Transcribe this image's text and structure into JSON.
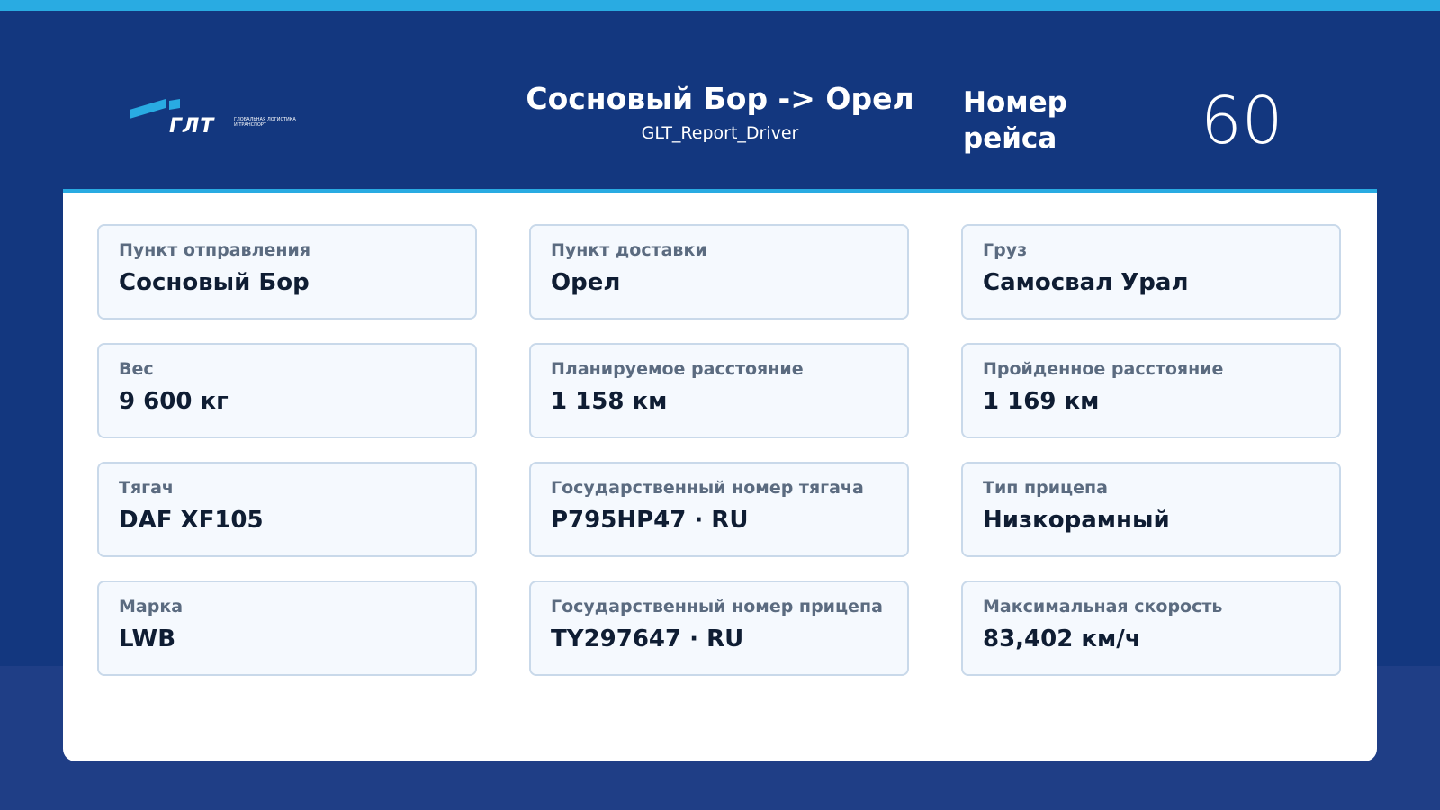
{
  "header": {
    "logo": {
      "brand": "ГЛТ",
      "tagline": "ГЛОБАЛЬНАЯ ЛОГИСТИКА И ТРАНСПОРТ"
    },
    "route_title": "Сосновый Бор -> Орел",
    "report_name": "GLT_Report_Driver",
    "trip_label": "Номер рейса",
    "trip_number": "60"
  },
  "colors": {
    "background": "#13377f",
    "accent": "#29abe2",
    "card_bg": "#f5f9fe",
    "card_border": "#c9d9ea"
  },
  "cards": [
    {
      "label": "Пункт отправления",
      "value": "Сосновый Бор"
    },
    {
      "label": "Пункт доставки",
      "value": "Орел"
    },
    {
      "label": "Груз",
      "value": "Самосвал Урал"
    },
    {
      "label": "Вес",
      "value": "9 600 кг"
    },
    {
      "label": "Планируемое расстояние",
      "value": "1 158 км"
    },
    {
      "label": "Пройденное расстояние",
      "value": "1 169 км"
    },
    {
      "label": "Тягач",
      "value": "DAF XF105"
    },
    {
      "label": "Государственный номер тягача",
      "value": "Р795НР47 · RU"
    },
    {
      "label": "Тип прицепа",
      "value": "Низкорамный"
    },
    {
      "label": "Марка",
      "value": "LWB"
    },
    {
      "label": "Государственный номер прицепа",
      "value": "TY297647 · RU"
    },
    {
      "label": "Максимальная скорость",
      "value": "83,402 км/ч"
    }
  ]
}
